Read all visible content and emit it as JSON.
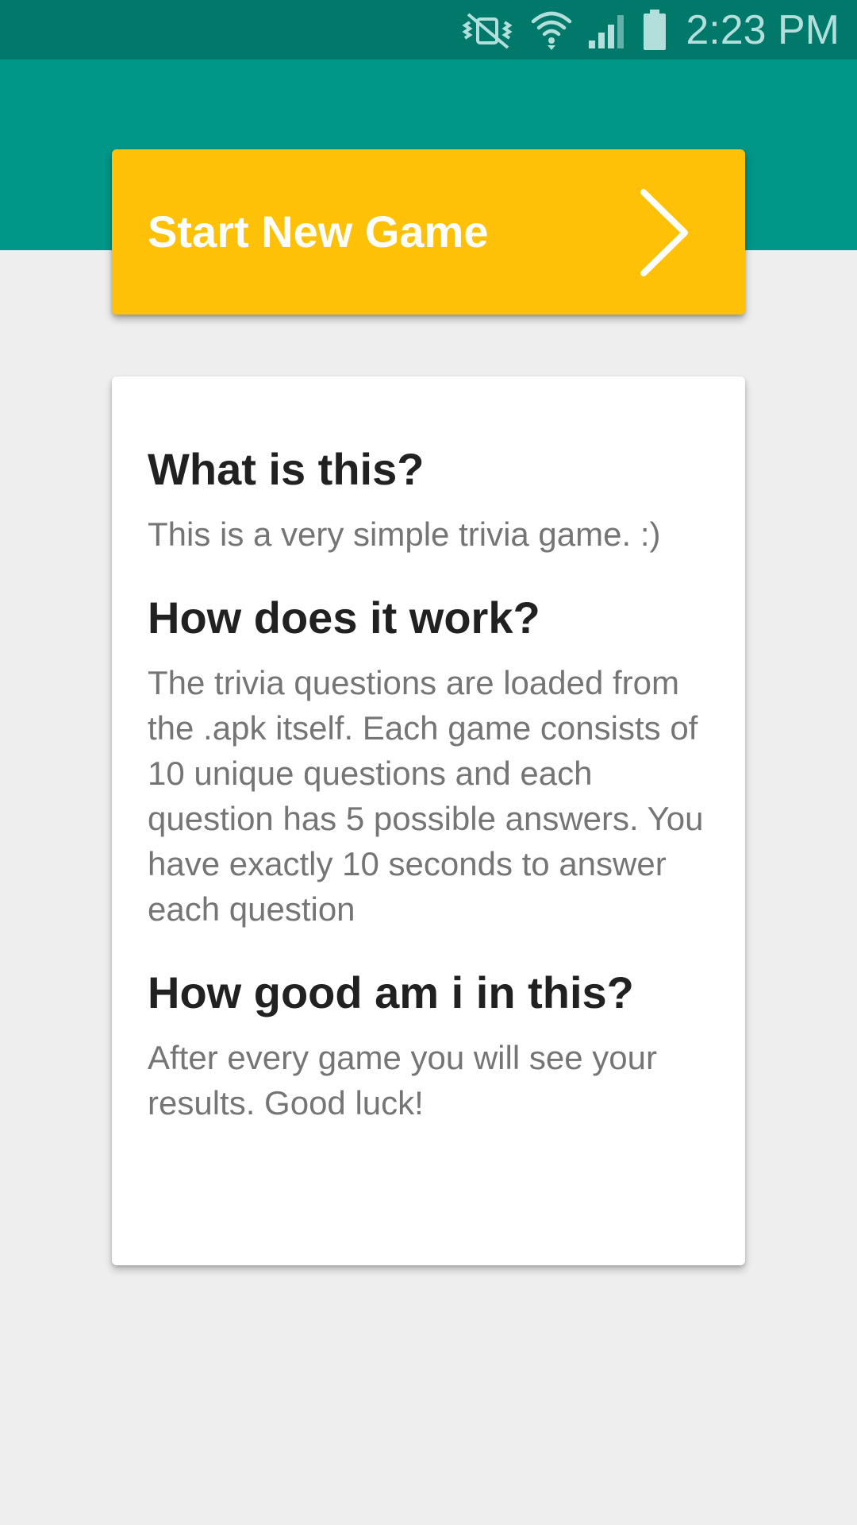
{
  "status_bar": {
    "time": "2:23 PM",
    "icons": [
      "vibrate-icon",
      "wifi-icon",
      "signal-icon",
      "battery-icon"
    ]
  },
  "colors": {
    "status_bar": "#00796B",
    "header": "#009688",
    "accent": "#FFC107",
    "background": "#EEEEEE",
    "card": "#FFFFFF",
    "title_text": "#212121",
    "body_text": "#757575"
  },
  "start_button": {
    "label": "Start New Game",
    "icon": "chevron-right-icon"
  },
  "info": {
    "sections": [
      {
        "title": "What is this?",
        "body": "This is a very simple trivia game. :)"
      },
      {
        "title": "How does it work?",
        "body": "The trivia questions are loaded from the .apk itself. Each game consists of 10 unique questions and each question has 5 possible answers. You have exactly 10 seconds to answer each question"
      },
      {
        "title": "How good am i in this?",
        "body": "After every game you will see your results. Good luck!"
      }
    ]
  }
}
